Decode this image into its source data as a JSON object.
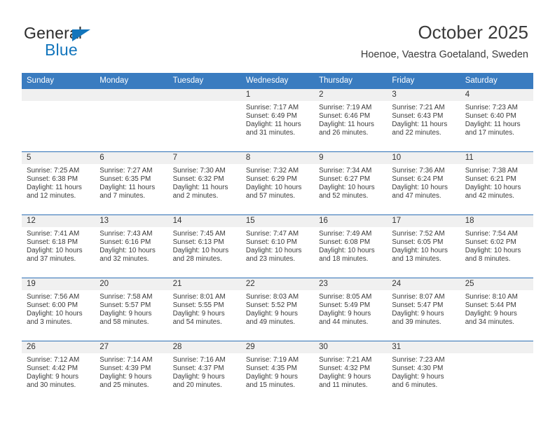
{
  "logo": {
    "word_top": "General",
    "word_bottom": "Blue",
    "triangle_color": "#1275bc"
  },
  "header": {
    "title": "October 2025",
    "subtitle": "Hoenoe, Vaestra Goetaland, Sweden",
    "accent_color": "#3a7cc0",
    "band_color": "#f0f0f0"
  },
  "weekday_headers": [
    "Sunday",
    "Monday",
    "Tuesday",
    "Wednesday",
    "Thursday",
    "Friday",
    "Saturday"
  ],
  "labels": {
    "sunrise_prefix": "Sunrise:",
    "sunset_prefix": "Sunset:",
    "daylight_prefix": "Daylight:"
  },
  "weeks": [
    [
      {
        "day": "",
        "empty": true
      },
      {
        "day": "",
        "empty": true
      },
      {
        "day": "",
        "empty": true
      },
      {
        "day": "1",
        "sunrise": "Sunrise: 7:17 AM",
        "sunset": "Sunset: 6:49 PM",
        "daylight1": "Daylight: 11 hours",
        "daylight2": "and 31 minutes."
      },
      {
        "day": "2",
        "sunrise": "Sunrise: 7:19 AM",
        "sunset": "Sunset: 6:46 PM",
        "daylight1": "Daylight: 11 hours",
        "daylight2": "and 26 minutes."
      },
      {
        "day": "3",
        "sunrise": "Sunrise: 7:21 AM",
        "sunset": "Sunset: 6:43 PM",
        "daylight1": "Daylight: 11 hours",
        "daylight2": "and 22 minutes."
      },
      {
        "day": "4",
        "sunrise": "Sunrise: 7:23 AM",
        "sunset": "Sunset: 6:40 PM",
        "daylight1": "Daylight: 11 hours",
        "daylight2": "and 17 minutes."
      }
    ],
    [
      {
        "day": "5",
        "sunrise": "Sunrise: 7:25 AM",
        "sunset": "Sunset: 6:38 PM",
        "daylight1": "Daylight: 11 hours",
        "daylight2": "and 12 minutes."
      },
      {
        "day": "6",
        "sunrise": "Sunrise: 7:27 AM",
        "sunset": "Sunset: 6:35 PM",
        "daylight1": "Daylight: 11 hours",
        "daylight2": "and 7 minutes."
      },
      {
        "day": "7",
        "sunrise": "Sunrise: 7:30 AM",
        "sunset": "Sunset: 6:32 PM",
        "daylight1": "Daylight: 11 hours",
        "daylight2": "and 2 minutes."
      },
      {
        "day": "8",
        "sunrise": "Sunrise: 7:32 AM",
        "sunset": "Sunset: 6:29 PM",
        "daylight1": "Daylight: 10 hours",
        "daylight2": "and 57 minutes."
      },
      {
        "day": "9",
        "sunrise": "Sunrise: 7:34 AM",
        "sunset": "Sunset: 6:27 PM",
        "daylight1": "Daylight: 10 hours",
        "daylight2": "and 52 minutes."
      },
      {
        "day": "10",
        "sunrise": "Sunrise: 7:36 AM",
        "sunset": "Sunset: 6:24 PM",
        "daylight1": "Daylight: 10 hours",
        "daylight2": "and 47 minutes."
      },
      {
        "day": "11",
        "sunrise": "Sunrise: 7:38 AM",
        "sunset": "Sunset: 6:21 PM",
        "daylight1": "Daylight: 10 hours",
        "daylight2": "and 42 minutes."
      }
    ],
    [
      {
        "day": "12",
        "sunrise": "Sunrise: 7:41 AM",
        "sunset": "Sunset: 6:18 PM",
        "daylight1": "Daylight: 10 hours",
        "daylight2": "and 37 minutes."
      },
      {
        "day": "13",
        "sunrise": "Sunrise: 7:43 AM",
        "sunset": "Sunset: 6:16 PM",
        "daylight1": "Daylight: 10 hours",
        "daylight2": "and 32 minutes."
      },
      {
        "day": "14",
        "sunrise": "Sunrise: 7:45 AM",
        "sunset": "Sunset: 6:13 PM",
        "daylight1": "Daylight: 10 hours",
        "daylight2": "and 28 minutes."
      },
      {
        "day": "15",
        "sunrise": "Sunrise: 7:47 AM",
        "sunset": "Sunset: 6:10 PM",
        "daylight1": "Daylight: 10 hours",
        "daylight2": "and 23 minutes."
      },
      {
        "day": "16",
        "sunrise": "Sunrise: 7:49 AM",
        "sunset": "Sunset: 6:08 PM",
        "daylight1": "Daylight: 10 hours",
        "daylight2": "and 18 minutes."
      },
      {
        "day": "17",
        "sunrise": "Sunrise: 7:52 AM",
        "sunset": "Sunset: 6:05 PM",
        "daylight1": "Daylight: 10 hours",
        "daylight2": "and 13 minutes."
      },
      {
        "day": "18",
        "sunrise": "Sunrise: 7:54 AM",
        "sunset": "Sunset: 6:02 PM",
        "daylight1": "Daylight: 10 hours",
        "daylight2": "and 8 minutes."
      }
    ],
    [
      {
        "day": "19",
        "sunrise": "Sunrise: 7:56 AM",
        "sunset": "Sunset: 6:00 PM",
        "daylight1": "Daylight: 10 hours",
        "daylight2": "and 3 minutes."
      },
      {
        "day": "20",
        "sunrise": "Sunrise: 7:58 AM",
        "sunset": "Sunset: 5:57 PM",
        "daylight1": "Daylight: 9 hours",
        "daylight2": "and 58 minutes."
      },
      {
        "day": "21",
        "sunrise": "Sunrise: 8:01 AM",
        "sunset": "Sunset: 5:55 PM",
        "daylight1": "Daylight: 9 hours",
        "daylight2": "and 54 minutes."
      },
      {
        "day": "22",
        "sunrise": "Sunrise: 8:03 AM",
        "sunset": "Sunset: 5:52 PM",
        "daylight1": "Daylight: 9 hours",
        "daylight2": "and 49 minutes."
      },
      {
        "day": "23",
        "sunrise": "Sunrise: 8:05 AM",
        "sunset": "Sunset: 5:49 PM",
        "daylight1": "Daylight: 9 hours",
        "daylight2": "and 44 minutes."
      },
      {
        "day": "24",
        "sunrise": "Sunrise: 8:07 AM",
        "sunset": "Sunset: 5:47 PM",
        "daylight1": "Daylight: 9 hours",
        "daylight2": "and 39 minutes."
      },
      {
        "day": "25",
        "sunrise": "Sunrise: 8:10 AM",
        "sunset": "Sunset: 5:44 PM",
        "daylight1": "Daylight: 9 hours",
        "daylight2": "and 34 minutes."
      }
    ],
    [
      {
        "day": "26",
        "sunrise": "Sunrise: 7:12 AM",
        "sunset": "Sunset: 4:42 PM",
        "daylight1": "Daylight: 9 hours",
        "daylight2": "and 30 minutes."
      },
      {
        "day": "27",
        "sunrise": "Sunrise: 7:14 AM",
        "sunset": "Sunset: 4:39 PM",
        "daylight1": "Daylight: 9 hours",
        "daylight2": "and 25 minutes."
      },
      {
        "day": "28",
        "sunrise": "Sunrise: 7:16 AM",
        "sunset": "Sunset: 4:37 PM",
        "daylight1": "Daylight: 9 hours",
        "daylight2": "and 20 minutes."
      },
      {
        "day": "29",
        "sunrise": "Sunrise: 7:19 AM",
        "sunset": "Sunset: 4:35 PM",
        "daylight1": "Daylight: 9 hours",
        "daylight2": "and 15 minutes."
      },
      {
        "day": "30",
        "sunrise": "Sunrise: 7:21 AM",
        "sunset": "Sunset: 4:32 PM",
        "daylight1": "Daylight: 9 hours",
        "daylight2": "and 11 minutes."
      },
      {
        "day": "31",
        "sunrise": "Sunrise: 7:23 AM",
        "sunset": "Sunset: 4:30 PM",
        "daylight1": "Daylight: 9 hours",
        "daylight2": "and 6 minutes."
      },
      {
        "day": "",
        "empty": true
      }
    ]
  ]
}
